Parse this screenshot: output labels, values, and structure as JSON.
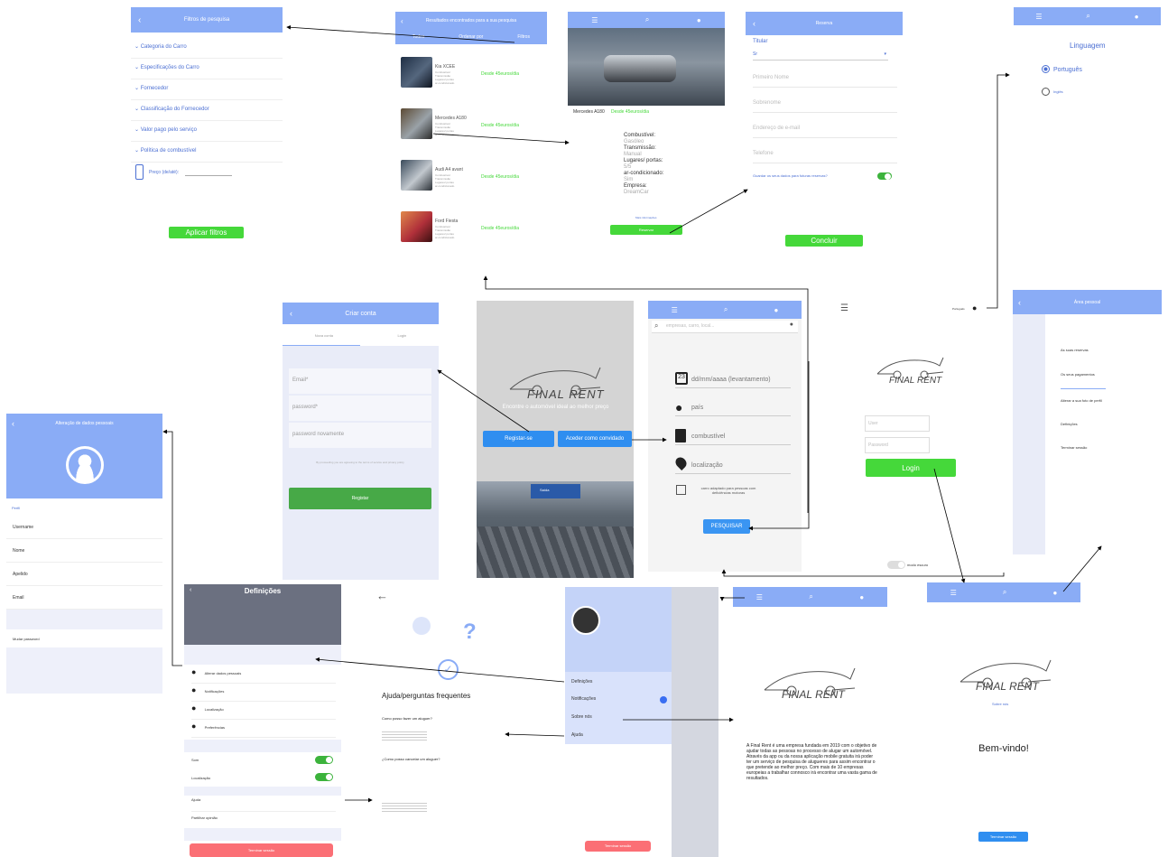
{
  "filters": {
    "title": "Filtros de pesquisa",
    "items": [
      "Categoria do Carro",
      "Especificações do Carro",
      "Fornecedor",
      "Classificação do Fornecedor",
      "Valor pago pelo serviço",
      "Política de combustível"
    ],
    "price_label": "Preço (de/até):",
    "apply": "Aplicar filtros"
  },
  "results": {
    "title": "Resultados encontrados para a sua pesquisa",
    "tabs": [
      "Todos",
      "Ordenar por",
      "Filtros"
    ],
    "cars": [
      {
        "name": "Kia XCEE",
        "price": "Desde 45euros/dia"
      },
      {
        "name": "Mercedes A180",
        "price": "Desde 45euros/dia"
      },
      {
        "name": "Audi A4 avant",
        "price": "Desde 45euros/dia"
      },
      {
        "name": "Ford Fiesta",
        "price": "Desde 45euros/dia"
      }
    ],
    "specs": "Combustível\nTransmissão\nLugares/ portas\nar-condicionado"
  },
  "detail": {
    "car": "Mercedes A180",
    "price": "Desde 45euros/dia",
    "specs": [
      [
        "Combustível:",
        "Gasóleo"
      ],
      [
        "Transmissão:",
        "Manual"
      ],
      [
        "Lugares/ portas:",
        "5/5"
      ],
      [
        "ar-condicionado:",
        "Sim"
      ],
      [
        "Empresa:",
        "DreamCar"
      ]
    ],
    "link": "Mais informações",
    "reserve": "Reservar"
  },
  "reserve": {
    "title": "Reserva",
    "titular": "Titular",
    "salutation": "Sr",
    "fields": [
      "Primeiro Nome",
      "Sobrenome",
      "Endereço de e-mail",
      "Telefone"
    ],
    "save": "Guardar os seus dados para futuras reservas?",
    "done": "Concluir"
  },
  "language": {
    "title": "Linguagem",
    "options": [
      "Português",
      "Inglês"
    ]
  },
  "create": {
    "title": "Criar conta",
    "tabs": [
      "Nova conta",
      "Login"
    ],
    "fields": [
      "Email*",
      "password*",
      "password novamente"
    ],
    "terms": "By proceeding you are agreeing to the terms of service and privacy policy",
    "submit": "Registar"
  },
  "splash": {
    "brand": "FINAL RENT",
    "tagline": "Encontre o automóvel ideal ao melhor preço",
    "register": "Registar-se",
    "guest": "Aceder como convidado",
    "sign": "Saída"
  },
  "search": {
    "placeholder": "empresas, carro, local...",
    "fields": [
      "dd/mm/aaaa (levantamento)",
      "país",
      "combustível",
      "localização"
    ],
    "accessible": "carro adaptado para pessoas com deficiências motoras",
    "button": "PESQUISAR"
  },
  "login": {
    "brand": "FINAL RENT",
    "user": "User",
    "password": "Password",
    "button": "Login",
    "lang": "Português",
    "dark": "modo escuro"
  },
  "area": {
    "title": "Área pessoal",
    "items": [
      "As suas reservas",
      "Os seus pagamentos",
      "Alterar a sua foto de perfil",
      "Definições",
      "Terminar sessão"
    ]
  },
  "personal": {
    "title": "Alteração de dados pessoais",
    "section": "Perfil",
    "fields": [
      "Username",
      "Nome",
      "Apelido",
      "Email"
    ],
    "password": "Mudar password"
  },
  "settings": {
    "title": "Definições",
    "items": [
      "Alterar dados pessoais",
      "Notificações",
      "Localização",
      "Preferências"
    ],
    "toggles": [
      "Som",
      "Localização"
    ],
    "more": [
      "Ajuda",
      "Partilhar opinião"
    ],
    "logout": "Terminar sessão"
  },
  "faq": {
    "title": "Ajuda/perguntas frequentes",
    "q1": "Como posso fazer um aluguer?",
    "q2": "¿Como posso cancelar um aluguer?"
  },
  "menu": {
    "items": [
      "Definições",
      "Notificações",
      "Sobre nós",
      "Ajuda"
    ],
    "logout": "Terminar sessão"
  },
  "about": {
    "brand": "FINAL RENT",
    "text": "A Final Rent é uma empresa fundada em 2019 com o objetivo de ajudar todas as pessoas no processo de alugar um automóvel. Através da app ou da nossa aplicação mobile gratuita irá poder ter um serviço de pesquisa de alugueres para assim encontrar o que pretende ao melhor preço. Com mais de 10 empresas europeias a trabalhar connosco irá encontrar uma vasta gama de resultados."
  },
  "welcome": {
    "brand": "FINAL RENT",
    "about": "Sobre nós",
    "greeting": "Bem-vindo!",
    "logout": "Terminar sessão"
  }
}
